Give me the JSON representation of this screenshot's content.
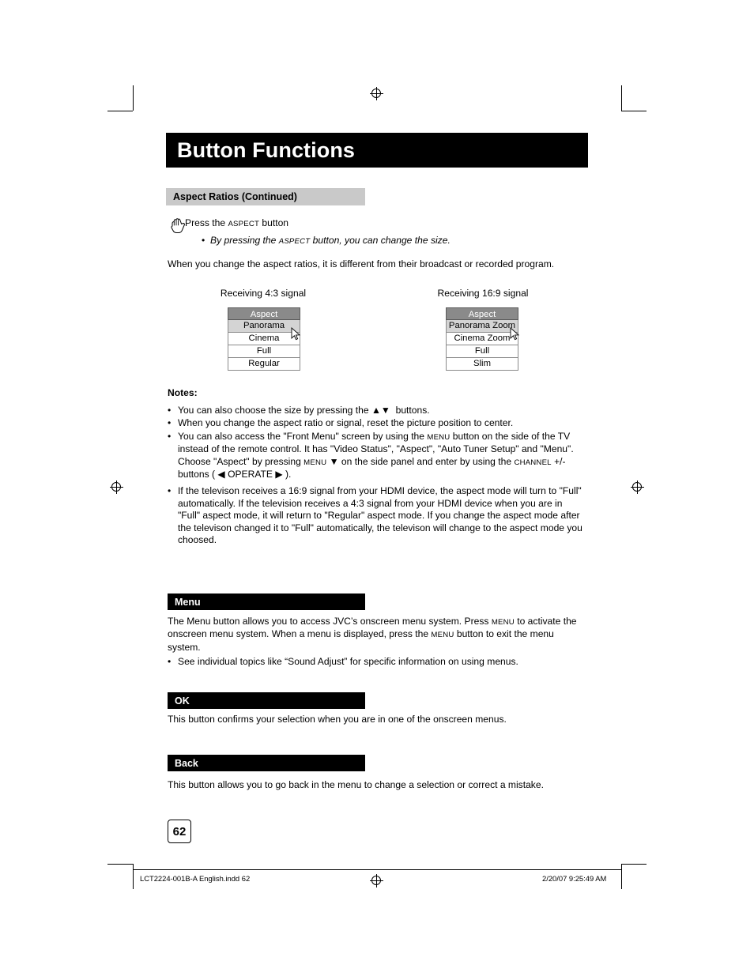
{
  "page": {
    "title": "Button Functions",
    "number": "62"
  },
  "sections": {
    "aspect": {
      "heading": "Aspect Ratios (Continued)",
      "press_line_pre": "Press the ",
      "press_line_caps": "Aspect",
      "press_line_post": " button",
      "bullet_pre": "By pressing the ",
      "bullet_caps": "Aspect",
      "bullet_post": " button, you can change the size.",
      "paragraph": "When you change the aspect ratios, it is different from their broadcast or recorded program."
    },
    "menu": {
      "heading": "Menu",
      "paragraph_1": "The Menu button allows you to access JVC’s onscreen menu system. Press ",
      "paragraph_1_caps": "Menu",
      "paragraph_1_b": " to activate the onscreen menu system.  When a menu is displayed, press the ",
      "paragraph_1_caps_b": "Menu",
      "paragraph_1_c": " button to exit the menu system.",
      "bullet": "See individual topics like “Sound Adjust” for specific information on using menus."
    },
    "ok": {
      "heading": "OK",
      "paragraph": "This button confirms your selection when you are in one of the onscreen menus."
    },
    "back": {
      "heading": "Back",
      "paragraph": "This button allows you to go back in the menu to change a selection or correct a mistake."
    }
  },
  "aspect_menus": [
    {
      "caption": "Receiving 4:3 signal",
      "header": "Aspect",
      "items": [
        "Panorama",
        "Cinema",
        "Full",
        "Regular"
      ],
      "selected_index": 0
    },
    {
      "caption": "Receiving 16:9 signal",
      "header": "Aspect",
      "items": [
        "Panorama Zoom",
        "Cinema Zoom",
        "Full",
        "Slim"
      ],
      "selected_index": 0
    }
  ],
  "notes": {
    "heading": "Notes:",
    "items": [
      {
        "parts": [
          {
            "t": "You can also choose the size by pressing the ",
            "s": "n"
          },
          {
            "t": "▲▼",
            "s": "n"
          },
          {
            "t": "  buttons.",
            "s": "n"
          }
        ]
      },
      {
        "parts": [
          {
            "t": "When you change the aspect ratio or signal, reset the picture position to center.",
            "s": "n"
          }
        ]
      },
      {
        "parts": [
          {
            "t": "You can also access the \"Front Menu\" screen by using the ",
            "s": "n"
          },
          {
            "t": "Menu",
            "s": "c"
          },
          {
            "t": " button on the side of the TV instead of the remote control.  It has \"Video Status\", \"Aspect\", \"Auto Tuner Setup\" and \"Menu\".  Choose \"Aspect\" by pressing ",
            "s": "n"
          },
          {
            "t": "Menu",
            "s": "c"
          },
          {
            "t": " ▼ on the side panel and enter by using the ",
            "s": "n"
          },
          {
            "t": "Channel",
            "s": "c"
          },
          {
            "t": " +/- buttons ( ◀ OPERATE ▶ ).",
            "s": "n"
          }
        ]
      },
      {
        "parts": [
          {
            "t": "If the televison receives a 16:9 signal from your HDMI device, the aspect mode will turn to \"Full\" automatically.  If the television receives a 4:3 signal from your HDMI device when you are in \"Full\" aspect mode, it will return to \"Regular\" aspect mode.  If you change the aspect mode after the televison changed it to \"Full\" automatically, the televison will change to the aspect mode you choosed.",
            "s": "n"
          }
        ]
      }
    ]
  },
  "footer": {
    "file": "LCT2224-001B-A English.indd   62",
    "date": "2/20/07   9:25:49 AM"
  }
}
